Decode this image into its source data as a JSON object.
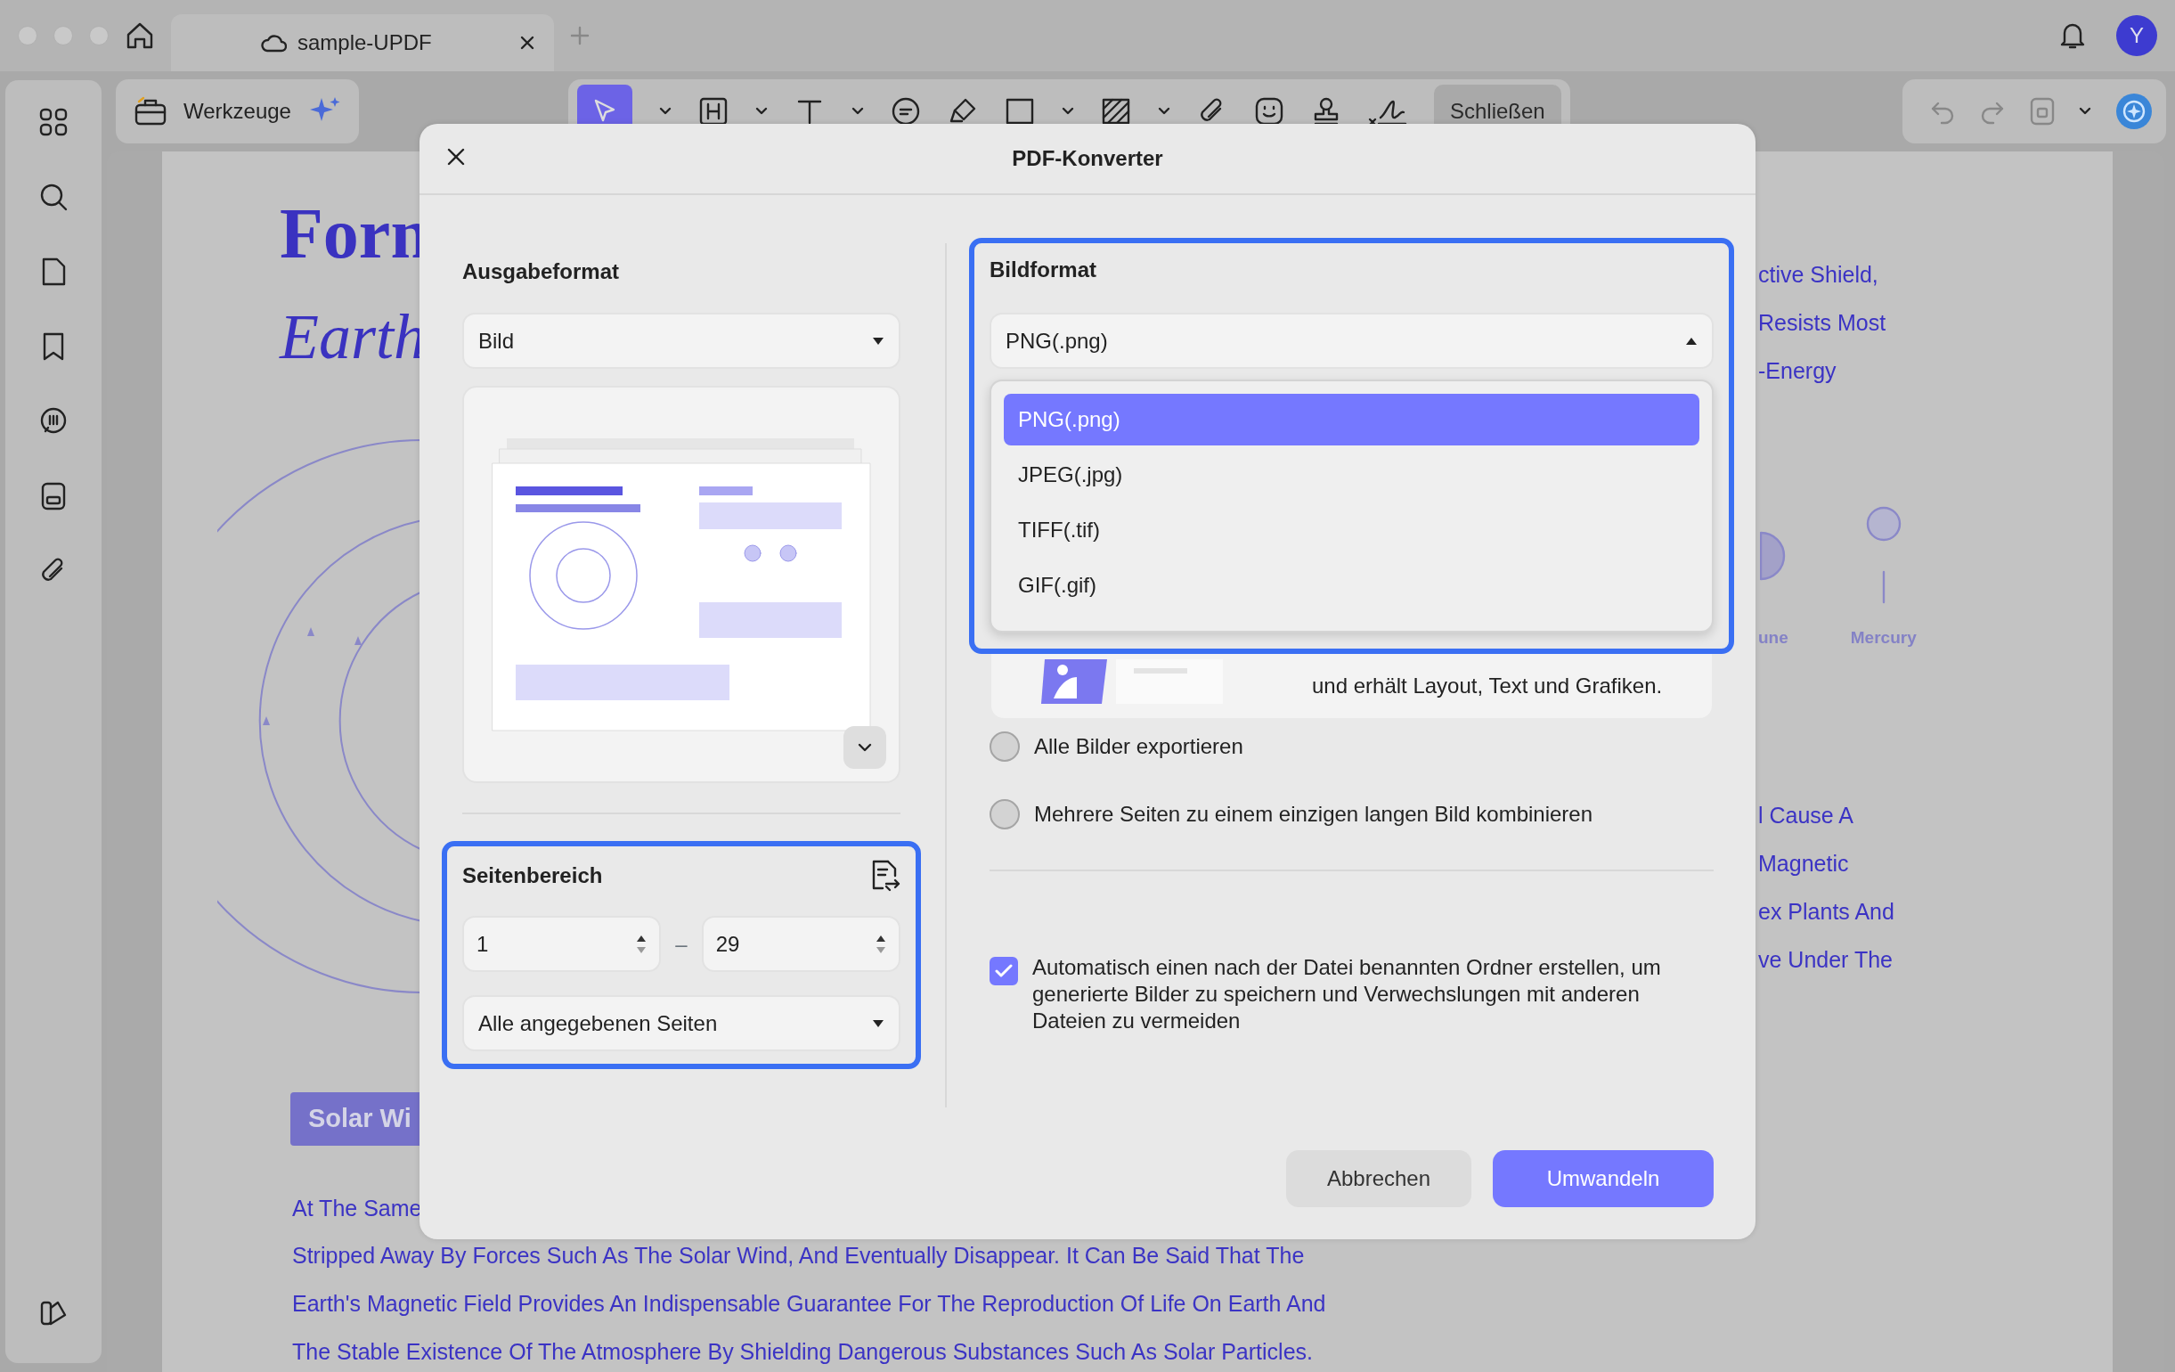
{
  "window": {
    "tab_title": "sample-UPDF",
    "avatar": "Y"
  },
  "toolbar": {
    "tools_label": "Werkzeuge",
    "close_label": "Schließen"
  },
  "document": {
    "title_fragment": "Forn",
    "subtitle_fragment": "Earth",
    "right_lines": [
      "ctive Shield,",
      "Resists Most",
      "-Energy"
    ],
    "planet_labels": [
      "une",
      "Mercury"
    ],
    "lower_right_lines": [
      "l Cause A",
      "Magnetic",
      "ex Plants And",
      "ve Under The"
    ],
    "section_badge": "Solar Wi",
    "paragraph_lines": [
      "At The Same",
      "Stripped Away By Forces Such As The Solar Wind, And Eventually Disappear. It Can Be Said That The",
      "Earth's Magnetic Field Provides An Indispensable Guarantee For The Reproduction Of Life On Earth And",
      "The Stable Existence Of The Atmosphere By Shielding Dangerous Substances Such As Solar Particles."
    ]
  },
  "dialog": {
    "title": "PDF-Konverter",
    "output_format": {
      "label": "Ausgabeformat",
      "value": "Bild"
    },
    "page_range": {
      "label": "Seitenbereich",
      "highlighted": true,
      "from": "1",
      "separator": "–",
      "to": "29",
      "subset": "Alle angegebenen Seiten"
    },
    "image_format": {
      "label": "Bildformat",
      "highlighted": true,
      "value": "PNG(.png)",
      "expanded": true,
      "options": [
        {
          "label": "PNG(.png)",
          "selected": true
        },
        {
          "label": "JPEG(.jpg)",
          "selected": false
        },
        {
          "label": "TIFF(.tif)",
          "selected": false
        },
        {
          "label": "GIF(.gif)",
          "selected": false
        }
      ]
    },
    "description_fragment": "und erhält Layout, Text und Grafiken.",
    "options": [
      {
        "label": "Alle Bilder exportieren",
        "selected": false
      },
      {
        "label": "Mehrere Seiten zu einem einzigen langen Bild kombinieren",
        "selected": false
      }
    ],
    "auto_folder": {
      "label": "Automatisch einen nach der Datei benannten Ordner erstellen, um generierte Bilder zu speichern und Verwechslungen mit anderen Dateien zu vermeiden",
      "checked": true
    },
    "buttons": [
      {
        "label": "Abbrechen",
        "kind": "secondary"
      },
      {
        "label": "Umwandeln",
        "kind": "primary"
      }
    ]
  }
}
